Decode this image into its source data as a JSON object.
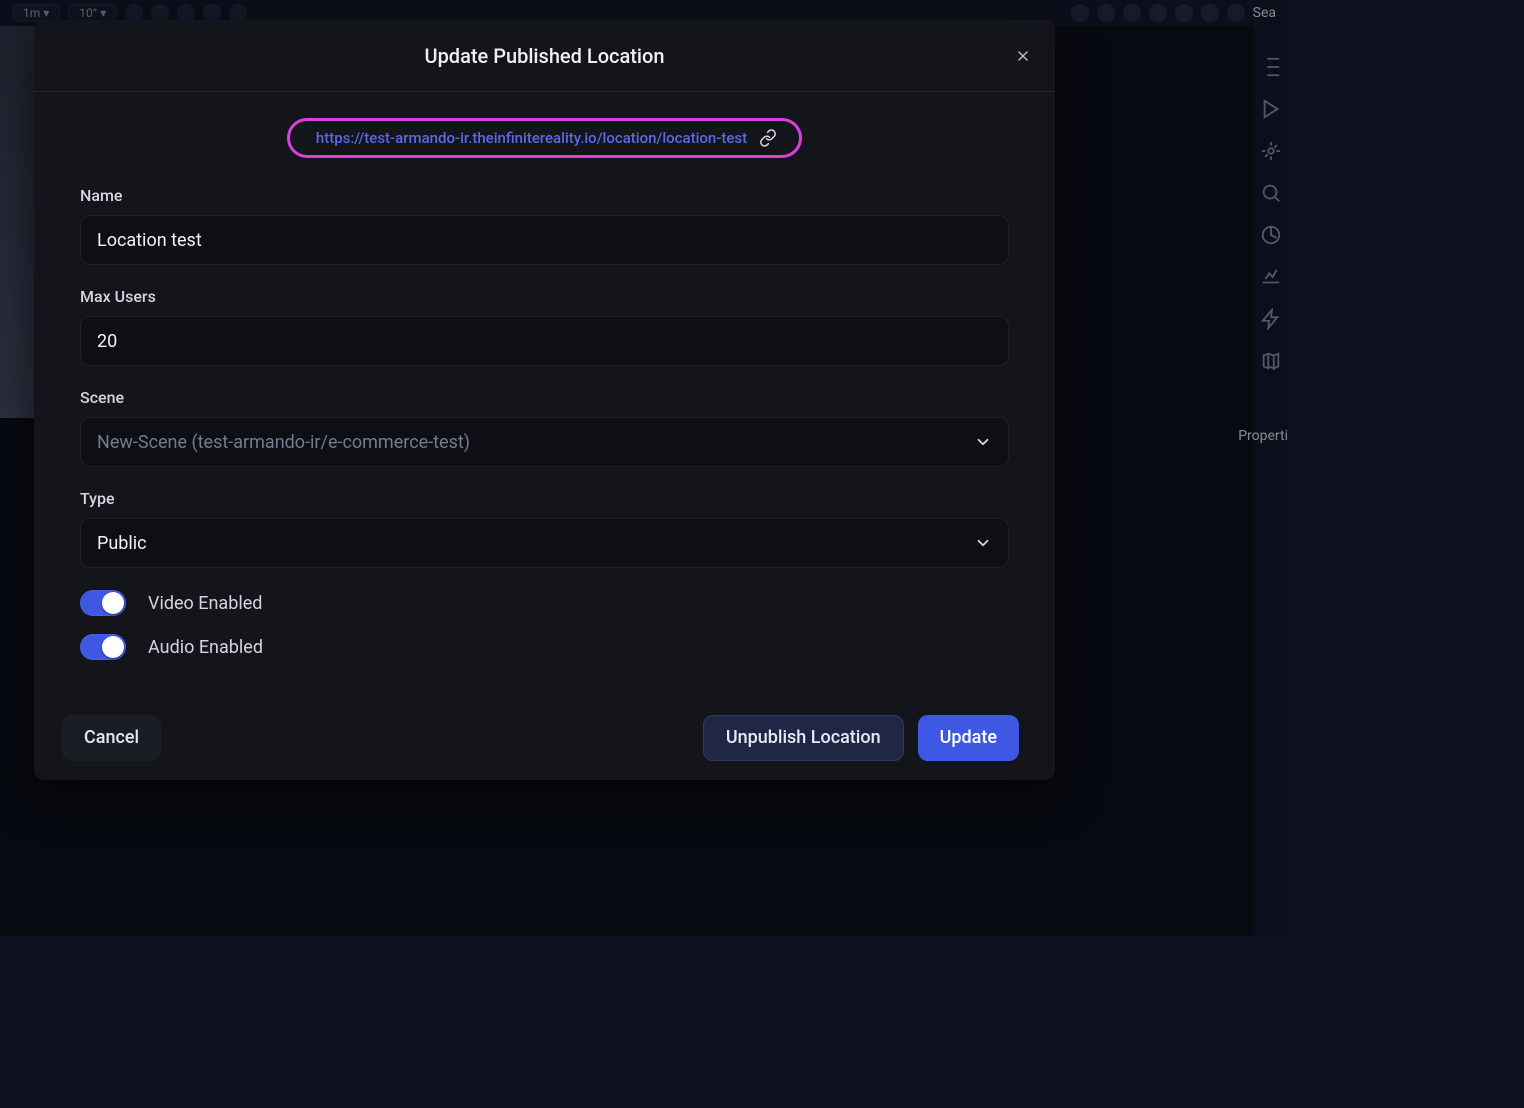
{
  "background": {
    "toolbar": {
      "chip1": "1m",
      "chip2": "10°",
      "search_stub": "Sea"
    },
    "properties_stub": "Properti"
  },
  "modal": {
    "title": "Update Published Location",
    "url": "https://test-armando-ir.theinfinitereality.io/location/location-test",
    "fields": {
      "name": {
        "label": "Name",
        "value": "Location test"
      },
      "max_users": {
        "label": "Max Users",
        "value": "20"
      },
      "scene": {
        "label": "Scene",
        "value": "New-Scene (test-armando-ir/e-commerce-test)"
      },
      "type": {
        "label": "Type",
        "value": "Public"
      }
    },
    "toggles": {
      "video": {
        "label": "Video Enabled",
        "on": true
      },
      "audio": {
        "label": "Audio Enabled",
        "on": true
      }
    },
    "buttons": {
      "cancel": "Cancel",
      "unpublish": "Unpublish Location",
      "update": "Update"
    }
  }
}
